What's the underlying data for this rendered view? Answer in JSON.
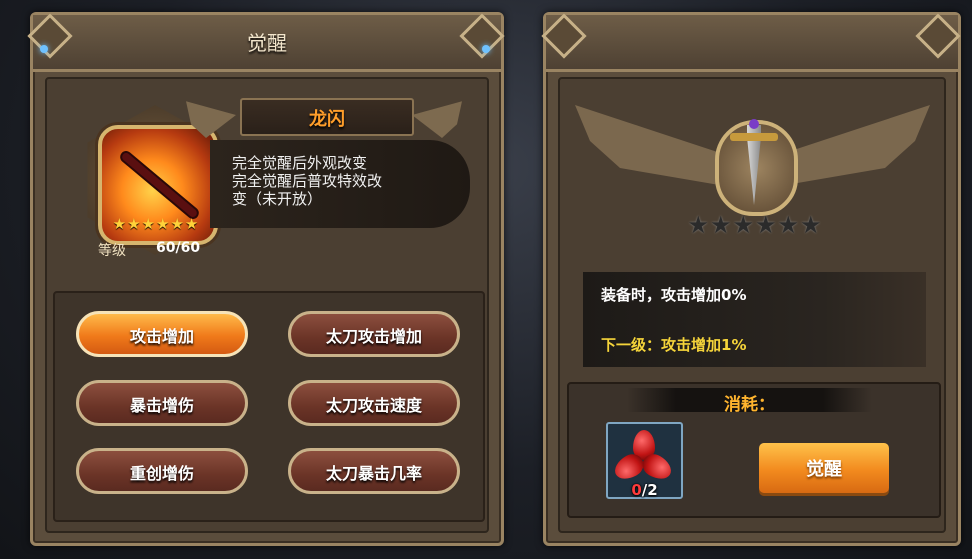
{
  "left_panel": {
    "title": "觉醒",
    "hero": {
      "name": "龙闪",
      "stars": "★★★★★★",
      "level_label": "等级",
      "level_value": "60/60",
      "description": "完全觉醒后外观改变\n完全觉醒后普攻特效改\n变（未开放）"
    },
    "attributes": [
      {
        "label": "攻击增加",
        "selected": true
      },
      {
        "label": "太刀攻击增加",
        "selected": false
      },
      {
        "label": "暴击增伤",
        "selected": false
      },
      {
        "label": "太刀攻击速度",
        "selected": false
      },
      {
        "label": "重创增伤",
        "selected": false
      },
      {
        "label": "太刀暴击几率",
        "selected": false
      }
    ]
  },
  "right_panel": {
    "badge_stars": "★★★★★★",
    "current_effect": "装备时，攻击增加0%",
    "next_effect": "下一级：攻击增加1%",
    "cost_title": "消耗：",
    "item": {
      "icon": "red-petal-shard-icon",
      "have": "0",
      "need": "/2"
    },
    "awaken_button": "觉醒"
  },
  "colors": {
    "accent_orange": "#f07a1a",
    "next_level_yellow": "#f5d43a",
    "name_orange": "#ff9e2a"
  }
}
